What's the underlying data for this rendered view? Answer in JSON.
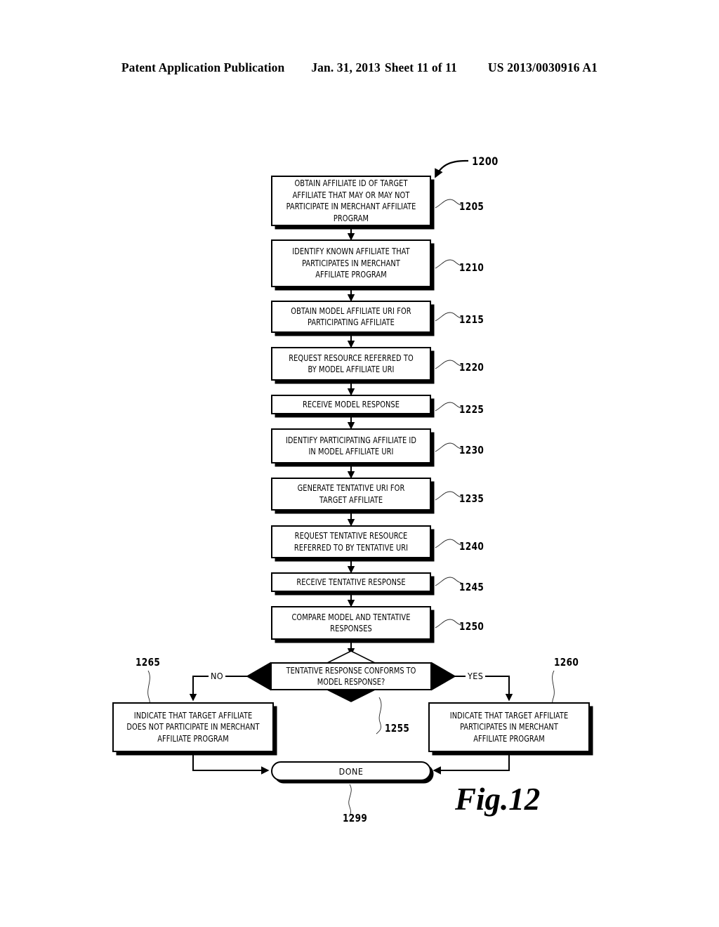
{
  "header": {
    "publication": "Patent Application Publication",
    "date": "Jan. 31, 2013",
    "sheet": "Sheet 11 of 11",
    "patent_number": "US 2013/0030916 A1"
  },
  "figure": {
    "caption": "Fig.12",
    "diagram_ref": "1200",
    "nodes": [
      {
        "ref": "1205",
        "text": "OBTAIN AFFILIATE ID OF TARGET AFFILIATE THAT MAY OR MAY NOT PARTICIPATE IN MERCHANT AFFILIATE PROGRAM"
      },
      {
        "ref": "1210",
        "text": "IDENTIFY KNOWN AFFILIATE THAT PARTICIPATES IN MERCHANT AFFILIATE PROGRAM"
      },
      {
        "ref": "1215",
        "text": "OBTAIN MODEL AFFILIATE URI FOR PARTICIPATING AFFILIATE"
      },
      {
        "ref": "1220",
        "text": "REQUEST RESOURCE REFERRED TO BY MODEL AFFILIATE URI"
      },
      {
        "ref": "1225",
        "text": "RECEIVE MODEL RESPONSE"
      },
      {
        "ref": "1230",
        "text": "IDENTIFY PARTICIPATING AFFILIATE ID IN MODEL AFFILIATE URI"
      },
      {
        "ref": "1235",
        "text": "GENERATE TENTATIVE URI FOR TARGET AFFILIATE"
      },
      {
        "ref": "1240",
        "text": "REQUEST TENTATIVE RESOURCE REFERRED TO BY TENTATIVE URI"
      },
      {
        "ref": "1245",
        "text": "RECEIVE TENTATIVE RESPONSE"
      },
      {
        "ref": "1250",
        "text": "COMPARE MODEL AND TENTATIVE RESPONSES"
      }
    ],
    "decision": {
      "ref": "1255",
      "text": "TENTATIVE RESPONSE CONFORMS TO MODEL RESPONSE?",
      "no_label": "NO",
      "yes_label": "YES"
    },
    "outcome_no": {
      "ref": "1265",
      "text": "INDICATE THAT TARGET AFFILIATE DOES NOT PARTICIPATE IN MERCHANT AFFILIATE PROGRAM"
    },
    "outcome_yes": {
      "ref": "1260",
      "text": "INDICATE THAT TARGET AFFILIATE PARTICIPATES IN MERCHANT AFFILIATE PROGRAM"
    },
    "terminator": {
      "ref": "1299",
      "text": "DONE"
    }
  }
}
